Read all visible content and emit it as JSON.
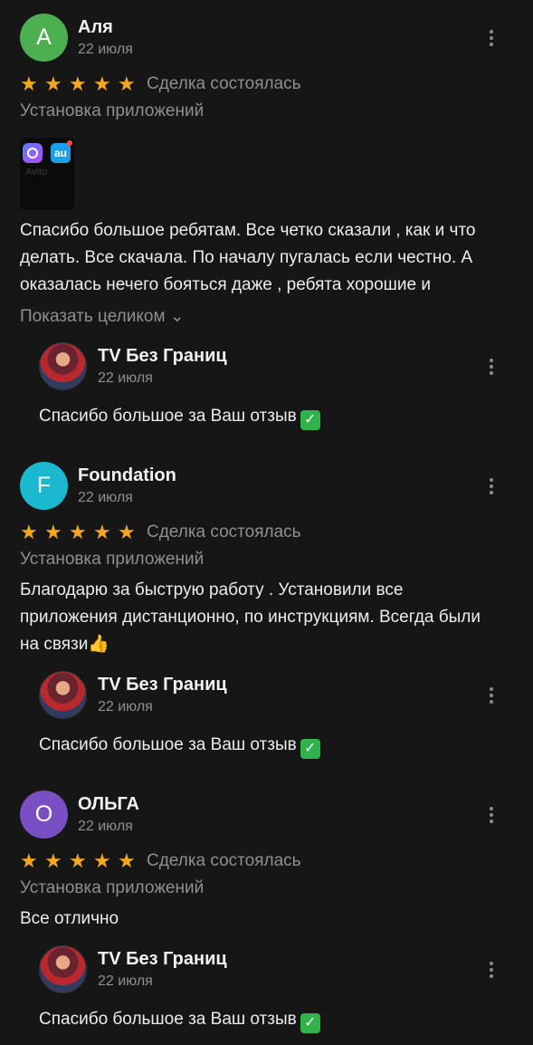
{
  "reviews": [
    {
      "avatar_letter": "А",
      "avatar_color": "#4caf50",
      "author": "Аля",
      "date": "22 июля",
      "stars": [
        "★",
        "★",
        "★",
        "★",
        "★"
      ],
      "deal_status": "Сделка состоялась",
      "category": "Установка приложений",
      "thumbnail_label": "Avito",
      "thumbnail_app2_label": "au",
      "text": "Спасибо большое ребятам. Все четко сказали , как и что делать. Все скачала. По началу пугалась если честно. А оказалась нечего бояться даже , ребята хорошие и",
      "show_more": "Показать целиком ⌄",
      "reply": {
        "author": "TV Без Границ",
        "date": "22 июля",
        "text": "Спасибо большое за Ваш отзыв",
        "emoji": "✓"
      }
    },
    {
      "avatar_letter": "F",
      "avatar_color": "#1ab9d0",
      "author": "Foundation",
      "date": "22 июля",
      "stars": [
        "★",
        "★",
        "★",
        "★",
        "★"
      ],
      "deal_status": "Сделка состоялась",
      "category": "Установка приложений",
      "text": "Благодарю за  быструю работу . Установили все приложения дистанционно, по инструкциям. Всегда были на связи👍",
      "reply": {
        "author": "TV Без Границ",
        "date": "22 июля",
        "text": "Спасибо большое за Ваш отзыв",
        "emoji": "✓"
      }
    },
    {
      "avatar_letter": "О",
      "avatar_color": "#7b4fc4",
      "author": "ОЛЬГА",
      "date": "22 июля",
      "stars": [
        "★",
        "★",
        "★",
        "★",
        "★"
      ],
      "deal_status": "Сделка состоялась",
      "category": "Установка приложений",
      "text": "Все отлично",
      "reply": {
        "author": "TV Без Границ",
        "date": "22 июля",
        "text": "Спасибо большое за Ваш отзыв",
        "emoji": "✓"
      }
    }
  ],
  "colors": {
    "background": "#161616",
    "star": "#f5a623",
    "secondary_text": "#8f8f8f",
    "check_badge": "#2fb34a"
  },
  "icons": {
    "more": "more-vertical-icon",
    "star": "star-icon",
    "check": "check-mark-icon"
  }
}
